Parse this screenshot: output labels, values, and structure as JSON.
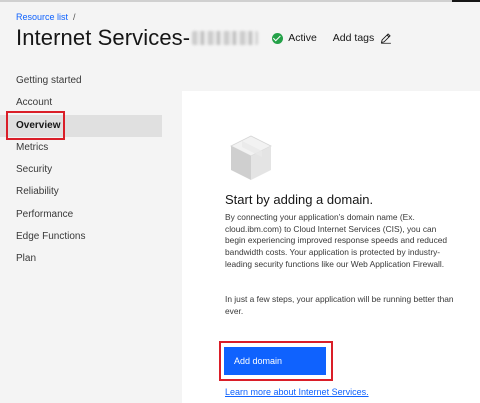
{
  "breadcrumb": {
    "items": [
      "Resource list"
    ],
    "separator": "/"
  },
  "header": {
    "title": "Internet Services-",
    "status_label": "Active",
    "status_color": "#24a148",
    "add_tags_label": "Add tags",
    "add_tags_icon": "pencil-icon"
  },
  "sidebar": {
    "items": [
      {
        "label": "Getting started"
      },
      {
        "label": "Account"
      },
      {
        "label": "Overview",
        "active": true
      },
      {
        "label": "Metrics"
      },
      {
        "label": "Security"
      },
      {
        "label": "Reliability"
      },
      {
        "label": "Performance"
      },
      {
        "label": "Edge Functions"
      },
      {
        "label": "Plan"
      }
    ]
  },
  "main": {
    "illustration_icon": "cube-icon",
    "heading": "Start by adding a domain.",
    "paragraph1": "By connecting your application’s domain name (Ex. cloud.ibm.com) to Cloud Internet Services (CIS), you can begin experiencing improved response speeds and reduced bandwidth costs. Your application is protected by industry-leading security functions like our Web Application Firewall.",
    "paragraph2": "In just a few steps, your application will be running better than ever.",
    "add_domain_label": "Add domain",
    "learn_more_label": "Learn more about Internet Services."
  },
  "colors": {
    "accent": "#0f62fe",
    "highlight_box": "#da1e28",
    "status": "#24a148"
  }
}
